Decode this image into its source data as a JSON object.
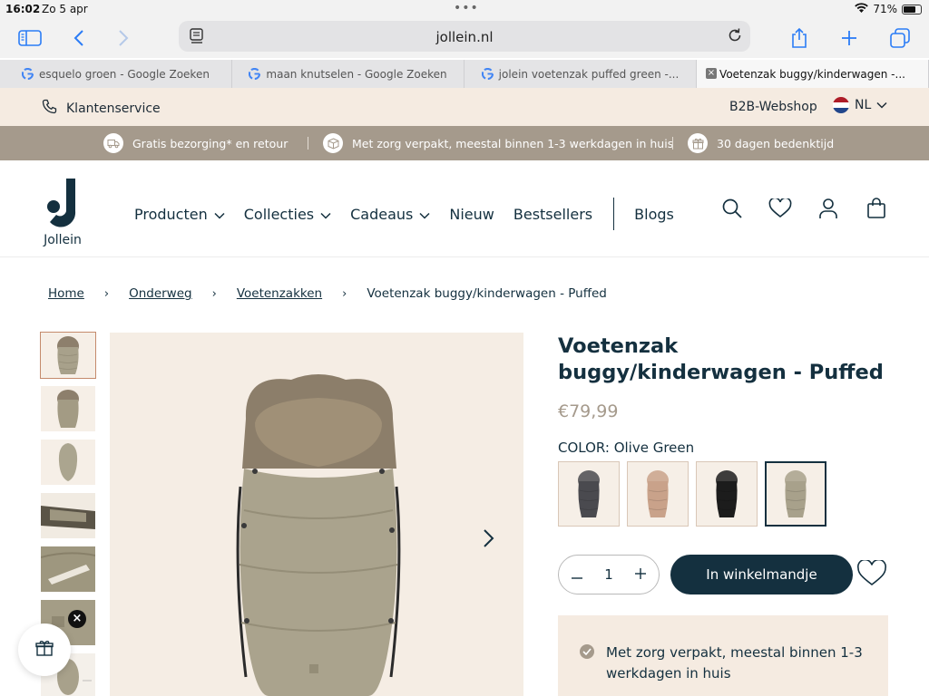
{
  "status": {
    "time": "16:02",
    "date": "Zo 5 apr",
    "battery": "71%",
    "battery_level": 0.71
  },
  "browser": {
    "url": "jollein.nl",
    "tabs": [
      {
        "title": "esquelo groen - Google Zoeken",
        "icon": "google-icon"
      },
      {
        "title": "maan knutselen - Google Zoeken",
        "icon": "google-icon"
      },
      {
        "title": "jolein voetenzak puffed green -...",
        "icon": "google-icon"
      },
      {
        "title": "Voetenzak buggy/kinderwagen -...",
        "icon": "close-icon",
        "active": true
      }
    ]
  },
  "topbar": {
    "customer_service": "Klantenservice",
    "b2b": "B2B-Webshop",
    "language": "NL"
  },
  "usp": [
    {
      "text": "Gratis bezorging* en retour",
      "icon": "truck-icon"
    },
    {
      "text": "Met zorg verpakt, meestal binnen 1-3 werkdagen in huis",
      "icon": "box-icon"
    },
    {
      "text": "30 dagen bedenktijd",
      "icon": "gift-icon"
    }
  ],
  "header": {
    "logo_text": "Jollein",
    "nav": [
      {
        "label": "Producten",
        "dropdown": true
      },
      {
        "label": "Collecties",
        "dropdown": true
      },
      {
        "label": "Cadeaus",
        "dropdown": true
      },
      {
        "label": "Nieuw",
        "dropdown": false
      },
      {
        "label": "Bestsellers",
        "dropdown": false
      }
    ],
    "blogs": "Blogs"
  },
  "breadcrumb": [
    {
      "label": "Home",
      "link": true
    },
    {
      "label": "Onderweg",
      "link": true
    },
    {
      "label": "Voetenzakken",
      "link": true
    },
    {
      "label": "Voetenzak buggy/kinderwagen - Puffed",
      "link": false
    }
  ],
  "product": {
    "title": "Voetenzak buggy/kinderwagen - Puffed",
    "price": "€79,99",
    "color_label": "COLOR: Olive Green",
    "swatches": [
      {
        "name": "grey",
        "color": "#4a4a4f"
      },
      {
        "name": "beige",
        "color": "#c9a28a"
      },
      {
        "name": "black",
        "color": "#1c1c1c"
      },
      {
        "name": "olive",
        "color": "#a8a18b",
        "selected": true
      }
    ],
    "quantity": "1",
    "add_to_cart": "In winkelmandje",
    "info_text": "Met zorg verpakt, meestal binnen 1-3 werkdagen in huis"
  },
  "colors": {
    "navy": "#14303f",
    "taupe": "#a59a8c",
    "cream": "#f5ebe1",
    "product": "#a8a18b"
  }
}
